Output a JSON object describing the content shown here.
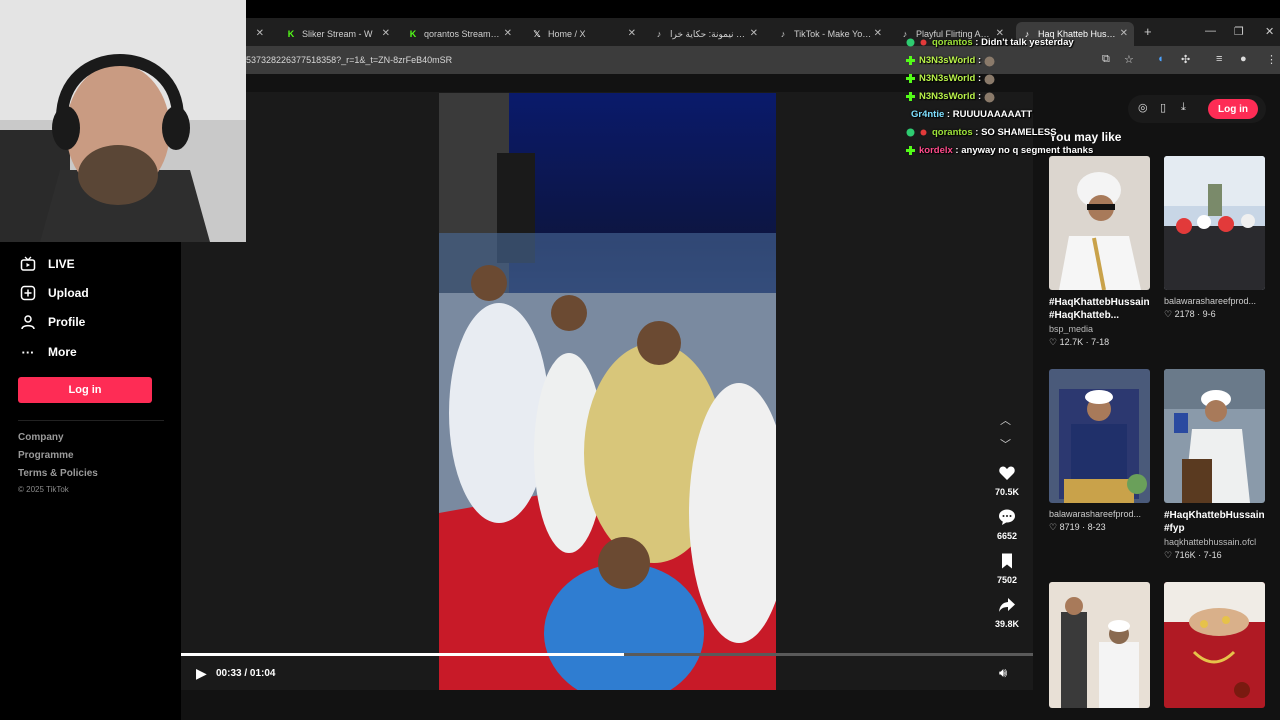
{
  "browser": {
    "tabs": [
      {
        "title": "Sliker Stream - W",
        "icon": "kick-icon"
      },
      {
        "title": "qorantos Stream - W",
        "icon": "kick-icon"
      },
      {
        "title": "Home / X",
        "icon": "x-icon"
      },
      {
        "title": "عماد نيمونة: حكاية خرا",
        "icon": "tiktok-icon"
      },
      {
        "title": "TikTok - Make Your D",
        "icon": "tiktok-icon"
      },
      {
        "title": "Playful Flirting Amon",
        "icon": "tiktok-icon"
      },
      {
        "title": "Haq Khatteb Hussain",
        "icon": "tiktok-icon",
        "active": true
      }
    ],
    "url": "537328226377518358?_r=1&_t=ZN-8zrFeB40mSR"
  },
  "left_nav": {
    "items": [
      {
        "label": "LIVE",
        "icon": "live-tv-icon"
      },
      {
        "label": "Upload",
        "icon": "plus-square-icon"
      },
      {
        "label": "Profile",
        "icon": "person-icon"
      },
      {
        "label": "More",
        "icon": "more-dots-icon"
      }
    ],
    "login_label": "Log in",
    "footer_links": [
      "Company",
      "Programme",
      "Terms & Policies"
    ],
    "copyright": "© 2025 TikTok"
  },
  "player": {
    "time_label": "00:33 / 01:04",
    "progress": 0.52,
    "actions": [
      {
        "name": "like",
        "icon": "heart-icon",
        "count": "70.5K"
      },
      {
        "name": "comment",
        "icon": "comment-icon",
        "count": "6652"
      },
      {
        "name": "save",
        "icon": "bookmark-icon",
        "count": "7502"
      },
      {
        "name": "share",
        "icon": "share-icon",
        "count": "39.8K"
      }
    ]
  },
  "right": {
    "login_label": "Log in",
    "section_title": "You may like",
    "cards": [
      {
        "title": "#HaqKhattebHussain #HaqKhatteb...",
        "author": "bsp_media",
        "likes": "12.7K",
        "date": "7-18"
      },
      {
        "title": "",
        "author": "balawarashareefprod...",
        "likes": "2178",
        "date": "9-6"
      },
      {
        "title": "",
        "author": "balawarashareefprod...",
        "likes": "8719",
        "date": "8-23"
      },
      {
        "title": "#HaqKhattebHussain #fyp",
        "author": "haqkhattebhussain.ofcl",
        "likes": "716K",
        "date": "7-16"
      },
      {
        "title": "",
        "author": "",
        "likes": "",
        "date": ""
      },
      {
        "title": "",
        "author": "",
        "likes": "",
        "date": ""
      }
    ]
  },
  "chat": [
    {
      "user": "qorantos",
      "color": "#9ee33a",
      "msg": "Didn't talk yesterday",
      "badge": "#2ecc71"
    },
    {
      "user": "N3N3sWorld",
      "color": "#b9f24a",
      "msg": "",
      "badge": "#53fc18"
    },
    {
      "user": "N3N3sWorld",
      "color": "#b9f24a",
      "msg": "",
      "badge": "#53fc18"
    },
    {
      "user": "N3N3sWorld",
      "color": "#b9f24a",
      "msg": "",
      "badge": "#53fc18"
    },
    {
      "user": "Gr4ntie",
      "color": "#7fe0ff",
      "msg": "RUUUUAAAAATT",
      "badge": ""
    },
    {
      "user": "qorantos",
      "color": "#9ee33a",
      "msg": "SO SHAMELESS",
      "badge": "#2ecc71"
    },
    {
      "user": "kordelx",
      "color": "#ff4b8b",
      "msg": "anyway no q segment thanks",
      "badge": "#53fc18"
    }
  ],
  "colors": {
    "accent": "#fe2c55",
    "page_bg": "#121212",
    "nav_bg": "#000000"
  }
}
